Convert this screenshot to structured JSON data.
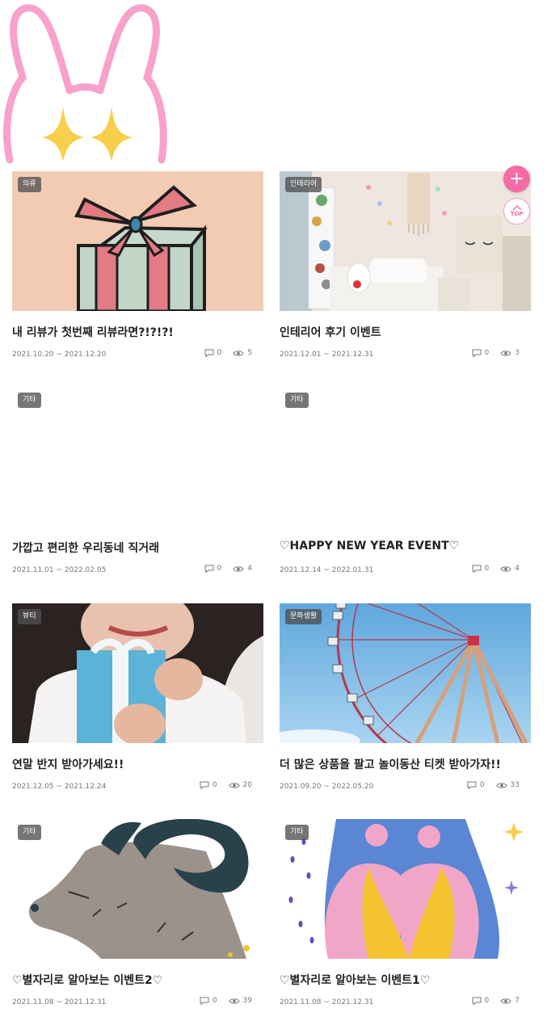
{
  "events": [
    {
      "category": "의류",
      "title": "내 리뷰가 첫번째 리뷰라면?!?!?!",
      "period": "2021.10.20 ~ 2021.12.20",
      "comments": "0",
      "views": "5"
    },
    {
      "category": "인테리어",
      "title": "인테리어 후기 이벤트",
      "period": "2021.12.01 ~ 2021.12.31",
      "comments": "0",
      "views": "3"
    },
    {
      "category": "기타",
      "title": "가깝고 편리한 우리동네 직거래",
      "period": "2021.11.01 ~ 2022.02.05",
      "comments": "0",
      "views": "4"
    },
    {
      "category": "기타",
      "title": "♡HAPPY NEW YEAR EVENT♡",
      "period": "2021.12.14 ~ 2022.01.31",
      "comments": "0",
      "views": "4"
    },
    {
      "category": "뷰티",
      "title": "연말 반지 받아가세요!!",
      "period": "2021.12.05 ~ 2021.12.24",
      "comments": "0",
      "views": "20"
    },
    {
      "category": "문화생활",
      "title": "더 많은 상품을 팔고 놀이동산 티켓 받아가자!!",
      "period": "2021.09.20 ~ 2022.05.20",
      "comments": "0",
      "views": "33"
    },
    {
      "category": "기타",
      "title": "♡별자리로 알아보는 이벤트2♡",
      "period": "2021.11.08 ~ 2021.12.31",
      "comments": "0",
      "views": "39"
    },
    {
      "category": "기타",
      "title": "♡별자리로 알아보는 이벤트1♡",
      "period": "2021.11.08 ~ 2021.12.31",
      "comments": "0",
      "views": "7"
    }
  ],
  "fab": {
    "plus_label": "+",
    "top_label": "TOP"
  },
  "icons": {
    "mascot": "bunny-sparkle-icon",
    "comment": "comment-icon",
    "view": "eye-icon"
  },
  "colors": {
    "accent": "#f46ba6",
    "badge_bg": "#505050",
    "muted_text": "#777777"
  }
}
